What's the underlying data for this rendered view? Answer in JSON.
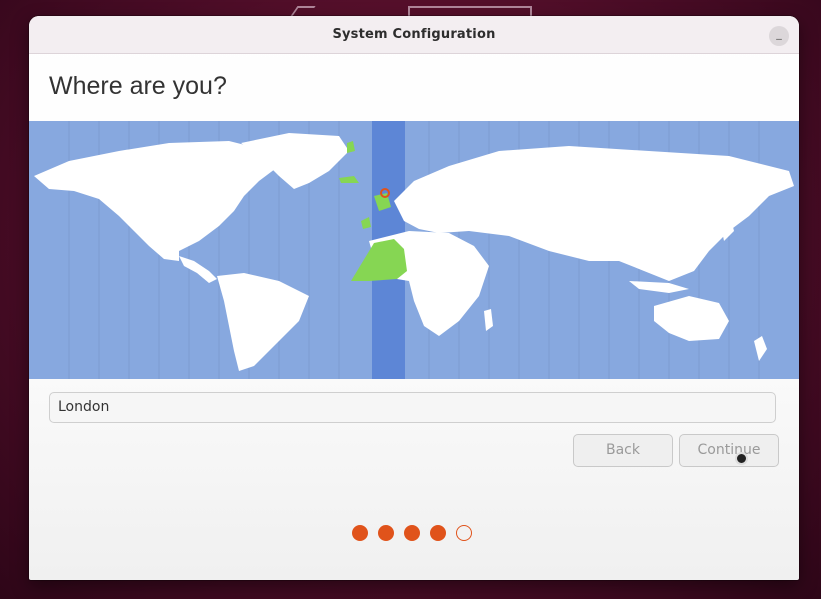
{
  "window": {
    "title": "System Configuration",
    "minimize_label": "_"
  },
  "page": {
    "heading": "Where are you?"
  },
  "timezone_map": {
    "selected_city": "London",
    "colors": {
      "water": "#87a8df",
      "land": "#ffffff",
      "highlight_band": "#5d86d6",
      "selected_zone": "#86d653",
      "marker": "#e0531b"
    }
  },
  "location_input": {
    "value": "London"
  },
  "buttons": {
    "back": "Back",
    "continue": "Continue"
  },
  "progress": {
    "current_step": 4,
    "total_steps": 5,
    "accent": "#e0531b"
  }
}
